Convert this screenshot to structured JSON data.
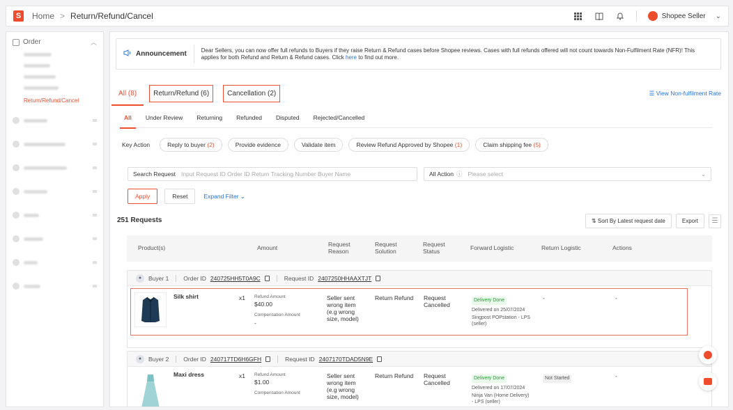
{
  "topbar": {
    "logo": "S",
    "home": "Home",
    "sep": ">",
    "current": "Return/Refund/Cancel",
    "icons": [
      "apps-grid-icon",
      "book-icon",
      "bell-icon"
    ],
    "seller_name": "Shopee Seller",
    "chevron": "⌄"
  },
  "sidebar": {
    "order_label": "Order",
    "active_item": "Return/Refund/Cancel"
  },
  "announcement": {
    "label": "Announcement",
    "text_before": "Dear Sellers, you can now offer full refunds to Buyers if they raise Return & Refund cases before Shopee reviews. Cases with full refunds offered will not count towards Non-Fulfilment Rate (NFR)! This applies for both Refund and Return & Refund cases. Click ",
    "link": "here",
    "text_after": " to find out more."
  },
  "tabs": {
    "all": "All (8)",
    "return_refund": "Return/Refund (6)",
    "cancellation": "Cancellation (2)",
    "nfr": "☰ View Non-fulfilment Rate"
  },
  "subtabs": [
    "All",
    "Under Review",
    "Returning",
    "Refunded",
    "Disputed",
    "Rejected/Cancelled"
  ],
  "key_action": {
    "label": "Key Action",
    "chips": [
      {
        "label": "Reply to buyer",
        "count": "(2)"
      },
      {
        "label": "Provide evidence",
        "count": ""
      },
      {
        "label": "Validate item",
        "count": ""
      },
      {
        "label": "Review Refund Approved by Shopee",
        "count": "(1)"
      },
      {
        "label": "Claim shipping fee",
        "count": "(5)"
      }
    ]
  },
  "search": {
    "label": "Search Request",
    "placeholder": "Input Request ID Order ID Return Tracking Number Buyer Name"
  },
  "all_action": {
    "label": "All Action",
    "help": "?",
    "placeholder": "Please select"
  },
  "buttons": {
    "apply": "Apply",
    "reset": "Reset",
    "expand": "Expand Filter ⌄"
  },
  "requests": {
    "count": "251 Requests",
    "sort": "⇅ Sort By Latest request date",
    "export": "Export",
    "menu": "☰"
  },
  "table_headers": {
    "product": "Product(s)",
    "amount": "Amount",
    "reason": [
      "Request",
      "Reason"
    ],
    "solution": [
      "Request",
      "Solution"
    ],
    "status": [
      "Request",
      "Status"
    ],
    "forward": "Forward Logistic",
    "return": "Return Logistic",
    "actions": "Actions"
  },
  "orders": [
    {
      "buyer": "Buyer 1",
      "order_label": "Order ID",
      "order_id": "240725HH5T0A9C",
      "request_label": "Request ID",
      "request_id": "2407250HHAAXTJT",
      "product": "Silk shirt",
      "qty": "x1",
      "refund_label": "Refund Amount",
      "refund": "$40.00",
      "comp_label": "Compensation Amount",
      "comp": "-",
      "reason": [
        "Seller sent",
        "wrong item",
        "(e.g wrong",
        "size, model)"
      ],
      "solution": "Return Refund",
      "status": [
        "Request",
        "Cancelled"
      ],
      "fwd_badge": "Delivery Done",
      "fwd_date": "Delivered on 25/07/2024",
      "fwd_carrier": [
        "Singpost POPstation - LPS",
        "(seller)"
      ],
      "return_logistic": "-",
      "actions": "-"
    },
    {
      "buyer": "Buyer 2",
      "order_label": "Order ID",
      "order_id": "240717TD6H6GFH",
      "request_label": "Request ID",
      "request_id": "2407170TDAD5N9E",
      "product": "Maxi dress",
      "qty": "x1",
      "refund_label": "Refund Amount",
      "refund": "$1.00",
      "comp_label": "Compensation Amount",
      "reason": [
        "Seller sent",
        "wrong item",
        "(e.g wrong",
        "size, model)"
      ],
      "solution": "Return Refund",
      "status": [
        "Request",
        "Cancelled"
      ],
      "fwd_badge": "Delivery Done",
      "fwd_date": "Delivered on 17/07/2024",
      "fwd_carrier": [
        "Ninja Van (Home Delivery)",
        "- LPS (seller)"
      ],
      "return_logistic": "Not Started",
      "actions": "-"
    }
  ],
  "colors": {
    "accent": "#ee4d2d",
    "link": "#2673dd",
    "success": "#2c9c3a"
  }
}
